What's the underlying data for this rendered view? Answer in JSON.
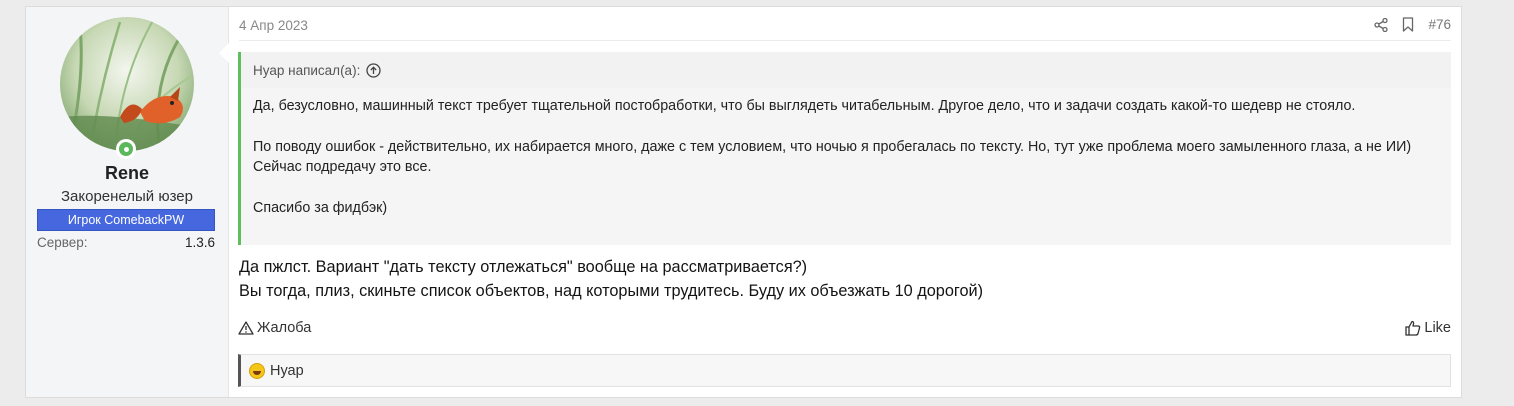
{
  "user": {
    "name": "Rene",
    "title": "Закоренелый юзер",
    "banner": "Игрок ComebackPW",
    "server_label": "Сервер:",
    "server_value": "1.3.6",
    "online": true
  },
  "post": {
    "date": "4 Апр 2023",
    "number": "#76"
  },
  "quote": {
    "author": "Нуар написал(а):",
    "paragraphs": [
      "Да, безусловно, машинный текст требует тщательной постобработки, что бы выглядеть читабельным. Другое дело, что и задачи создать какой-то шедевр не стояло.",
      "По поводу ошибок - действительно, их набирается много, даже с тем условием, что ночью я пробегалась по тексту. Но, тут уже проблема моего замыленного глаза, а не ИИ) Сейчас подредачу это все.",
      "Спасибо за фидбэк)"
    ]
  },
  "message": {
    "lines": [
      "Да пжлст. Вариант \"дать тексту отлежаться\" вообще на рассматривается?)",
      "Вы тогда, плиз, скиньте список объектов, над которыми трудитесь. Буду их объезжать 10 дорогой)"
    ]
  },
  "actions": {
    "report": "Жалоба",
    "like": "Like"
  },
  "reactions": {
    "users": "Нуар",
    "emoji": "laughing-face"
  },
  "colors": {
    "banner": "#4667dd",
    "quote_border": "#5fbf5f",
    "online": "#5cb85c"
  }
}
